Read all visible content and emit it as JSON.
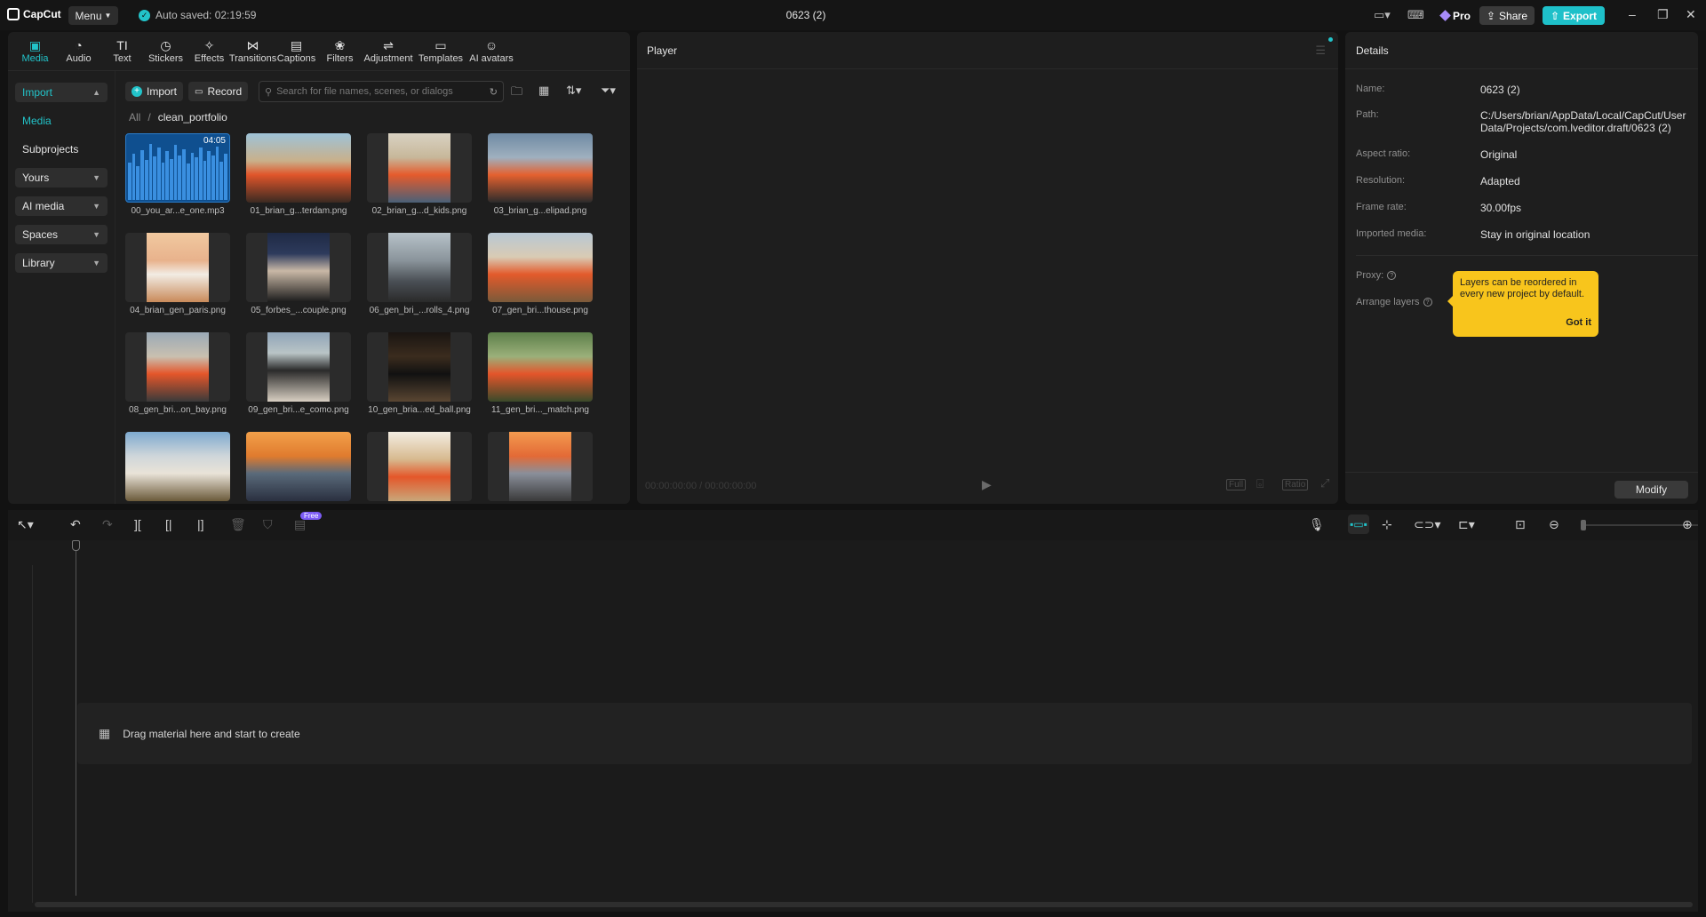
{
  "app": {
    "brand": "CapCut",
    "menu_label": "Menu",
    "autosave": "Auto saved: 02:19:59",
    "project_title": "0623 (2)",
    "pro_label": "Pro",
    "share_label": "Share",
    "export_label": "Export"
  },
  "toolbar": {
    "tabs": [
      {
        "label": "Media",
        "icon": "media-icon"
      },
      {
        "label": "Audio",
        "icon": "audio-icon"
      },
      {
        "label": "Text",
        "icon": "text-icon"
      },
      {
        "label": "Stickers",
        "icon": "stickers-icon"
      },
      {
        "label": "Effects",
        "icon": "effects-icon"
      },
      {
        "label": "Transitions",
        "icon": "transitions-icon"
      },
      {
        "label": "Captions",
        "icon": "captions-icon"
      },
      {
        "label": "Filters",
        "icon": "filters-icon"
      },
      {
        "label": "Adjustment",
        "icon": "adjustment-icon"
      },
      {
        "label": "Templates",
        "icon": "templates-icon"
      },
      {
        "label": "AI avatars",
        "icon": "ai-avatars-icon"
      }
    ]
  },
  "sidebar": {
    "items": [
      {
        "label": "Import"
      },
      {
        "label": "Media"
      },
      {
        "label": "Subprojects"
      },
      {
        "label": "Yours"
      },
      {
        "label": "AI media"
      },
      {
        "label": "Spaces"
      },
      {
        "label": "Library"
      }
    ]
  },
  "media": {
    "import_label": "Import",
    "record_label": "Record",
    "search_placeholder": "Search for file names, scenes, or dialogs",
    "breadcrumb_root": "All",
    "breadcrumb_separator": "/",
    "breadcrumb_current": "clean_portfolio",
    "audio_duration": "04:05",
    "files": [
      "00_you_ar...e_one.mp3",
      "01_brian_g...terdam.png",
      "02_brian_g...d_kids.png",
      "03_brian_g...elipad.png",
      "04_brian_gen_paris.png",
      "05_forbes_...couple.png",
      "06_gen_bri_...rolls_4.png",
      "07_gen_bri...thouse.png",
      "08_gen_bri...on_bay.png",
      "09_gen_bri...e_como.png",
      "10_gen_bria...ed_ball.png",
      "11_gen_bri..._match.png",
      "",
      "",
      "",
      ""
    ]
  },
  "player": {
    "title": "Player",
    "timecode": "00:00:00:00 / 00:00:00:00",
    "full_label": "Full",
    "ratio_label": "Ratio"
  },
  "details": {
    "title": "Details",
    "rows": [
      {
        "key": "Name:",
        "value": "0623 (2)"
      },
      {
        "key": "Path:",
        "value": "C:/Users/brian/AppData/Local/CapCut/User Data/Projects/com.lveditor.draft/0623 (2)"
      },
      {
        "key": "Aspect ratio:",
        "value": "Original"
      },
      {
        "key": "Resolution:",
        "value": "Adapted"
      },
      {
        "key": "Frame rate:",
        "value": "30.00fps"
      },
      {
        "key": "Imported media:",
        "value": "Stay in original location"
      }
    ],
    "proxy_label": "Proxy:",
    "arrange_label": "Arrange layers",
    "tooltip_text": "Layers can be reordered in every new project by default.",
    "tooltip_button": "Got it",
    "modify_label": "Modify"
  },
  "timeline": {
    "free_badge": "Free",
    "drop_hint": "Drag material here and start to create"
  },
  "colors": {
    "accent": "#22c3c9",
    "tooltip": "#f8c51c",
    "background": "#121212",
    "panel": "#1e1e1e"
  }
}
